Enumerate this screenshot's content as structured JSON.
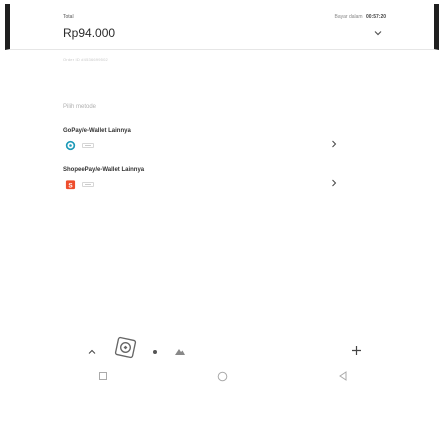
{
  "header": {
    "total_label": "Total",
    "pay_within_label": "Bayar dalam",
    "timer": "00:57:20",
    "amount": "Rp94.000",
    "order_id": "Order ID #4536699502"
  },
  "payment": {
    "choose_label": "Pilih metode",
    "methods": [
      {
        "title": "GoPay/e-Wallet Lainnya",
        "logo": "gopay-logo"
      },
      {
        "title": "ShopeePay/e-Wallet Lainnya",
        "logo": "shopeepay-logo"
      }
    ]
  },
  "colors": {
    "gopay": "#00aed6",
    "shopee": "#ee4d2d",
    "frame": "#1f1f1f"
  }
}
